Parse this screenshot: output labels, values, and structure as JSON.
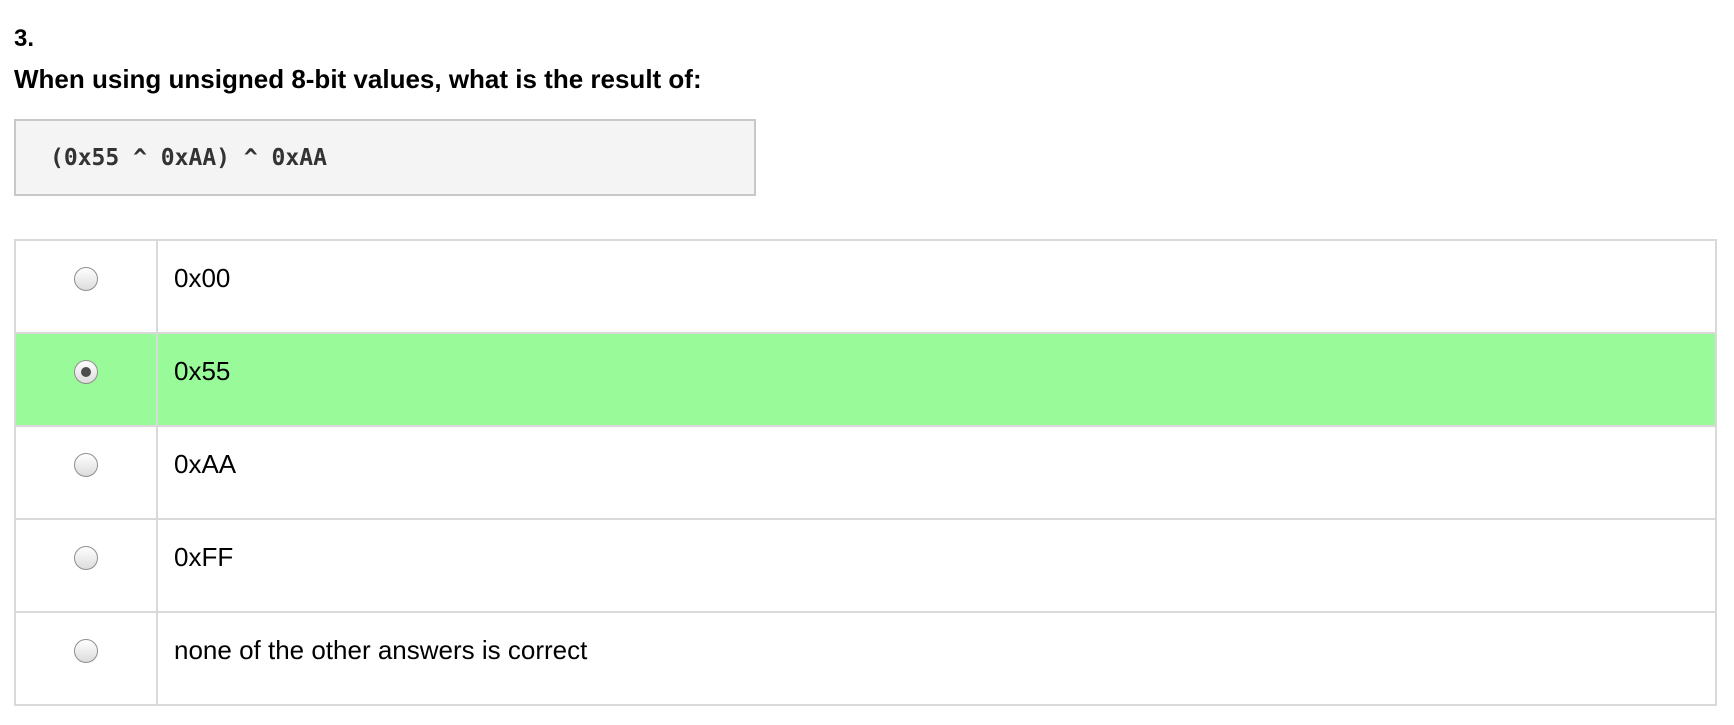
{
  "question": {
    "number": "3.",
    "text": "When using unsigned 8-bit values, what is the result of:",
    "code": "(0x55 ^ 0xAA) ^ 0xAA"
  },
  "answers": [
    {
      "label": "0x00",
      "selected": false
    },
    {
      "label": "0x55",
      "selected": true
    },
    {
      "label": "0xAA",
      "selected": false
    },
    {
      "label": "0xFF",
      "selected": false
    },
    {
      "label": "none of the other answers is correct",
      "selected": false
    }
  ],
  "colors": {
    "selected_row": "#99fa99",
    "code_background": "#f4f4f4",
    "border": "#d9d9d9"
  }
}
